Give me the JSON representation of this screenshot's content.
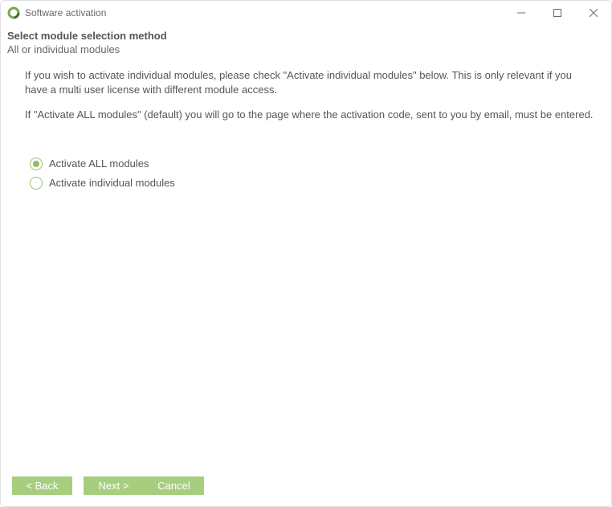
{
  "window": {
    "title": "Software activation"
  },
  "page": {
    "heading": "Select module selection method",
    "subheading": "All or individual modules",
    "para1": "If you wish to activate individual modules, please check \"Activate individual modules\" below. This is only relevant if you have a multi user license with different module access.",
    "para2": "If \"Activate ALL modules\" (default) you will go to the page where the activation code, sent to you by email, must be entered."
  },
  "options": {
    "all": "Activate ALL modules",
    "individual": "Activate individual modules",
    "selected": "all"
  },
  "buttons": {
    "back": "< Back",
    "next": "Next >",
    "cancel": "Cancel"
  }
}
